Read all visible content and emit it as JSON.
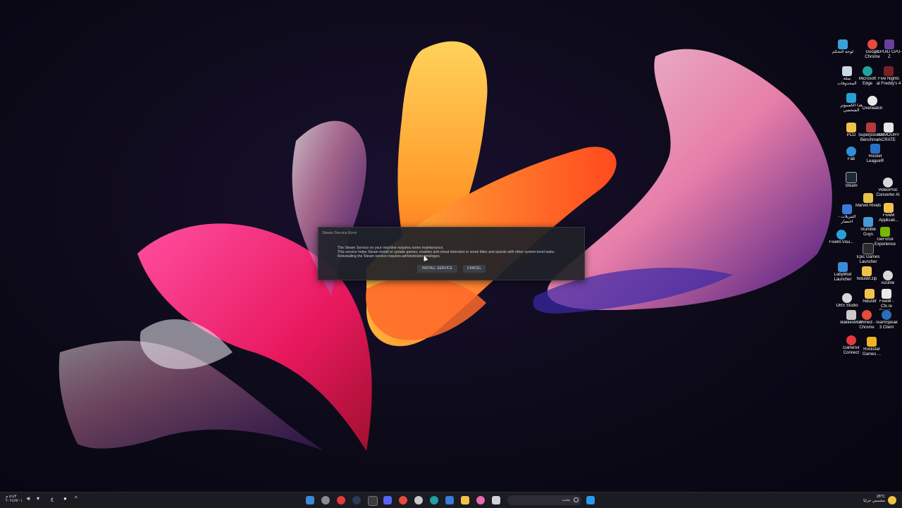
{
  "dialog": {
    "title": "Steam Service Error",
    "line1": "The Steam Service on your machine requires some maintenance.",
    "line2": "This service helps Steam install or update games, enables anti-cheat detection in some titles and assists with other system level tasks.",
    "line3": "Reinstalling the Steam service requires administrator privileges.",
    "install_label": "INSTALL SERVICE",
    "cancel_label": "CANCEL"
  },
  "desktop_icons": [
    {
      "label": "لوحة التحكم",
      "icon": "control-panel-icon",
      "color": "#3aa0d8"
    },
    {
      "label": "Google Chrome",
      "icon": "chrome-icon",
      "color": "#e84a3c"
    },
    {
      "label": "CPUID CPU-Z",
      "icon": "cpu-z-icon",
      "color": "#6a3fa0"
    },
    {
      "label": "سلة المحذوفات",
      "icon": "recycle-bin-icon",
      "color": "#c9d7e6"
    },
    {
      "label": "Microsoft Edge",
      "icon": "edge-icon",
      "color": "#1fa3a0"
    },
    {
      "label": "Five Nights at Freddy's 4",
      "icon": "fnaf-icon",
      "color": "#7a1f24"
    },
    {
      "label": "هذا الكمبيوتر الشخصي",
      "icon": "this-pc-icon",
      "color": "#27a0d6"
    },
    {
      "label": "Overwatch",
      "icon": "overwatch-icon",
      "color": "#e9e9e9"
    },
    {
      "label": "PCD",
      "icon": "folder-icon",
      "color": "#f1c24a"
    },
    {
      "label": "Superposition Benchmark",
      "icon": "superposition-icon",
      "color": "#b33b3b"
    },
    {
      "label": "ARMOURY CRATE",
      "icon": "armoury-crate-icon",
      "color": "#e5e5e5"
    },
    {
      "label": "Fab",
      "icon": "fab-icon",
      "color": "#2f8fd8"
    },
    {
      "label": "Rocket League®",
      "icon": "rocket-league-icon",
      "color": "#2b6fc4"
    },
    {
      "label": "Steam",
      "icon": "steam-icon",
      "color": "#1b2838"
    },
    {
      "label": "VideoProc Converter AI",
      "icon": "videoproc-icon",
      "color": "#d8d8d8"
    },
    {
      "label": "التنزيلات - اختصار",
      "icon": "downloads-icon",
      "color": "#3a7ad8"
    },
    {
      "label": "Marvel Rivals",
      "icon": "marvel-rivals-icon",
      "color": "#e7c34a"
    },
    {
      "label": "FiveM Applicati...",
      "icon": "fivem-app-icon",
      "color": "#f1c24a"
    },
    {
      "label": "Stumble Guys",
      "icon": "stumble-guys-icon",
      "color": "#4a9ad8"
    },
    {
      "label": "GeForce Experience",
      "icon": "geforce-icon",
      "color": "#76b900"
    },
    {
      "label": "FiveM.Visu...",
      "icon": "fivem-visual-icon",
      "color": "#2aa0d8"
    },
    {
      "label": "Epic Games Launcher",
      "icon": "epic-games-icon",
      "color": "#2a2a2a"
    },
    {
      "label": "LabyMod Launcher",
      "icon": "labymod-icon",
      "color": "#3a8ad8"
    },
    {
      "label": "hidusbf.zip",
      "icon": "zip-icon",
      "color": "#f1c24a"
    },
    {
      "label": "Azurite",
      "icon": "azurite-icon",
      "color": "#d8d8d8"
    },
    {
      "label": "OBS Studio",
      "icon": "obs-icon",
      "color": "#d8d8d8"
    },
    {
      "label": "hidusbf",
      "icon": "folder-icon",
      "color": "#f1c24a"
    },
    {
      "label": "FiveM - Cfx.re Devel...",
      "icon": "fivem-dev-icon",
      "color": "#e9e9e9"
    },
    {
      "label": "BakkesMod",
      "icon": "bakkesmod-icon",
      "color": "#c9c9c9"
    },
    {
      "label": "Ahmed - Chrome",
      "icon": "chrome-profile-icon",
      "color": "#e84a3c"
    },
    {
      "label": "TeamSpeak 3 Client",
      "icon": "teamspeak-icon",
      "color": "#2a6fb8"
    },
    {
      "label": "GameSir Connect",
      "icon": "gamesir-icon",
      "color": "#e63a3a"
    },
    {
      "label": "Rockstar Games ...",
      "icon": "rockstar-icon",
      "color": "#f1b324"
    }
  ],
  "taskbar": {
    "search_placeholder": "بحث",
    "weather_temp": "28°C",
    "weather_text": "مشمس جزئيًا",
    "time": "٥:٤٣ م",
    "date": "٢٠٢٤/٧/٠١",
    "lang": "ع"
  }
}
